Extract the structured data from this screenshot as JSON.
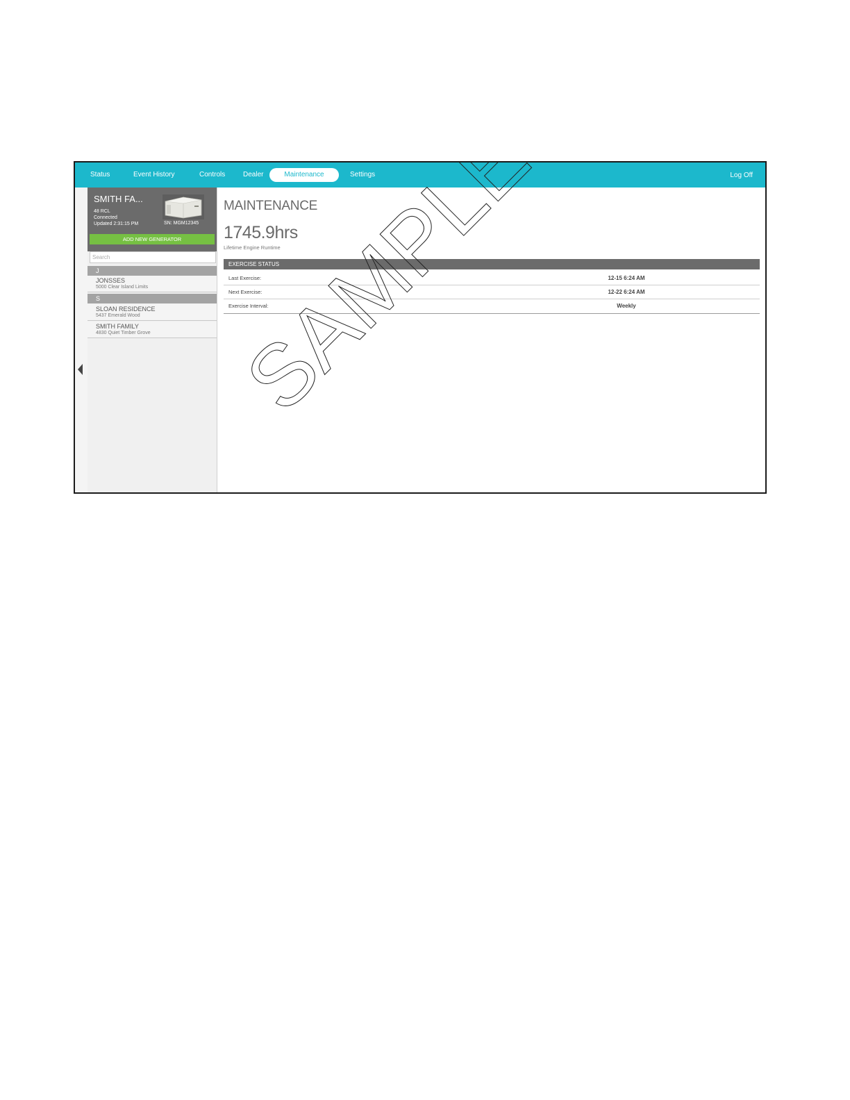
{
  "nav": {
    "items": [
      {
        "label": "Status"
      },
      {
        "label": "Event History"
      },
      {
        "label": "Controls"
      },
      {
        "label": "Dealer"
      },
      {
        "label": "Maintenance",
        "active": true
      },
      {
        "label": "Settings"
      }
    ],
    "logoff_label": "Log Off"
  },
  "sidebar": {
    "generator": {
      "name": "SMITH FA...",
      "model": "48 RCL",
      "status": "Connected",
      "updated": "Updated 2:31:15 PM",
      "serial": "SN: MGM12345"
    },
    "add_button_label": "ADD NEW GENERATOR",
    "search_placeholder": "Search",
    "groups": [
      {
        "letter": "J",
        "items": [
          {
            "name": "JONSSES",
            "address": "5000 Clear Island Limits"
          }
        ]
      },
      {
        "letter": "S",
        "items": [
          {
            "name": "SLOAN RESIDENCE",
            "address": "5437 Emerald Wood"
          },
          {
            "name": "SMITH FAMILY",
            "address": "4830 Quiet Timber Grove"
          }
        ]
      }
    ]
  },
  "main": {
    "title": "MAINTENANCE",
    "runtime_value": "1745.9hrs",
    "runtime_label": "Lifetime Engine Runtime",
    "section_title": "EXERCISE STATUS",
    "rows": [
      {
        "label": "Last Exercise:",
        "value": "12-15 6:24 AM"
      },
      {
        "label": "Next Exercise:",
        "value": "12-22 6:24 AM"
      },
      {
        "label": "Exercise Interval:",
        "value": "Weekly"
      }
    ]
  },
  "watermark": "SAMPLE",
  "colors": {
    "nav_bg": "#1cb8cc",
    "card_bg": "#6b6b6b",
    "add_button": "#76c043",
    "group_header": "#a3a3a3"
  },
  "icons": [
    "collapse-left-icon",
    "generator-image"
  ]
}
